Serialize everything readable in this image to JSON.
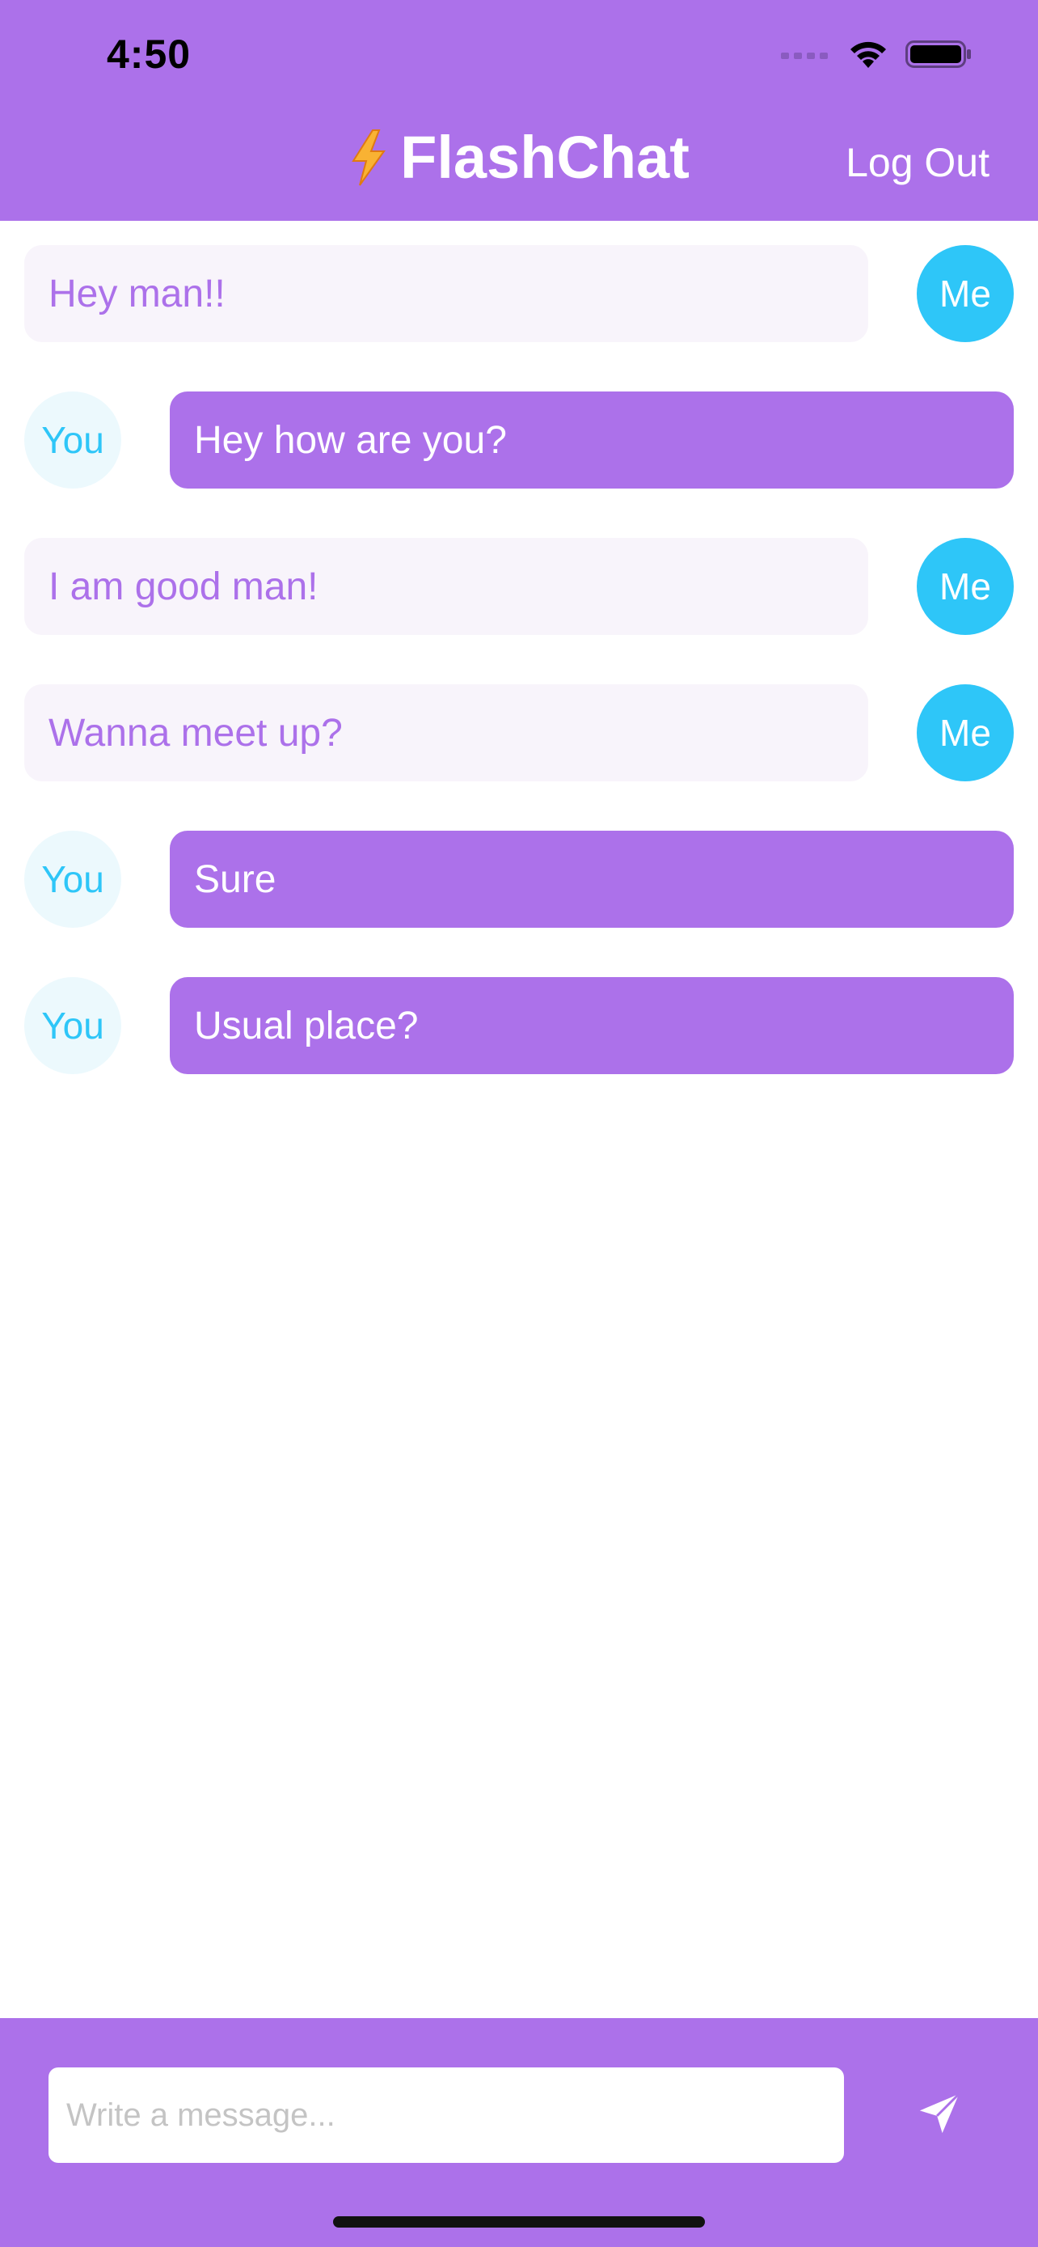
{
  "status_bar": {
    "time": "4:50"
  },
  "nav": {
    "app_title": "FlashChat",
    "logout_label": "Log Out",
    "title_icon": "lightning-bolt-icon"
  },
  "messages": [
    {
      "sender": "me",
      "text": "Hey man!!",
      "avatar_label": "Me"
    },
    {
      "sender": "you",
      "text": "Hey how are you?",
      "avatar_label": "You"
    },
    {
      "sender": "me",
      "text": "I am good man!",
      "avatar_label": "Me"
    },
    {
      "sender": "me",
      "text": "Wanna meet up?",
      "avatar_label": "Me"
    },
    {
      "sender": "you",
      "text": "Sure",
      "avatar_label": "You"
    },
    {
      "sender": "you",
      "text": "Usual place?",
      "avatar_label": "You"
    }
  ],
  "composer": {
    "placeholder": "Write a message...",
    "value": "",
    "send_icon": "send-icon"
  },
  "colors": {
    "brand_purple": "#AC71EA",
    "me_bubble_bg": "#F8F4FB",
    "me_avatar_bg": "#2EC6F8",
    "you_avatar_bg": "#ECF9FD"
  }
}
